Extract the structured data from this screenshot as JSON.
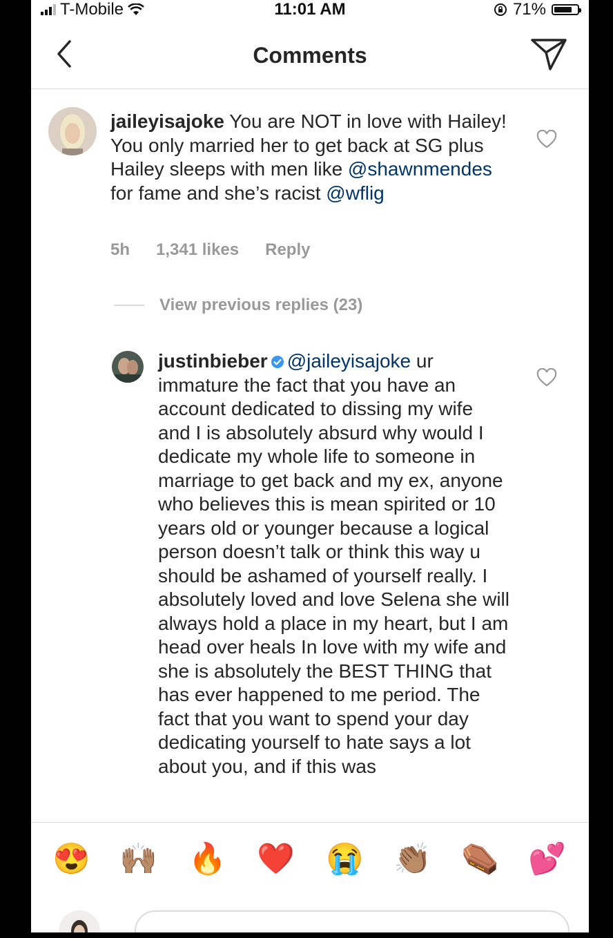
{
  "status_bar": {
    "carrier": "T-Mobile",
    "time": "11:01 AM",
    "battery_text": "71%",
    "battery_level": 0.71
  },
  "nav": {
    "title": "Comments",
    "back_icon": "chevron-left-icon",
    "send_icon": "paper-plane-icon"
  },
  "comments": [
    {
      "username": "jaileyisajoke",
      "text_before": " You are NOT in love with Hailey! You only married her to get back at SG plus Hailey sleeps with men like ",
      "mention1": "@shawnmendes",
      "text_middle": " for fame and she’s racist ",
      "mention2": "@wflig",
      "time": "5h",
      "likes": "1,341 likes",
      "reply": "Reply"
    }
  ],
  "view_replies": "View previous replies (23)",
  "reply": {
    "username": "justinbieber",
    "mention": "@jaileyisajoke",
    "text": " ur immature the fact that you have an account dedicated to dissing my wife and I is absolutely absurd why would I dedicate my whole life to someone in marriage to get back and my ex, anyone who believes this is mean spirited or 10 years old or younger because a logical person doesn’t talk or think this way u should be ashamed of yourself really.  I absolutely loved and love Selena she will always hold a place in my heart, but I am head over heals In love with my wife and she is absolutely the BEST THING that has ever happened to me period. The fact that you want to spend your day dedicating yourself to hate says a lot about you, and if this was"
  },
  "emojis": [
    "😍",
    "🙌🏽",
    "🔥",
    "❤️",
    "😭",
    "👏🏽",
    "⚰️",
    "💕"
  ],
  "colors": {
    "mention": "#003569",
    "meta": "#999999",
    "divider": "#dbdbdb"
  }
}
